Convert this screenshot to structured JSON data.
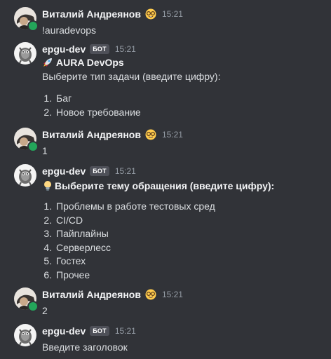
{
  "messages": [
    {
      "author": "Виталий Андреянов",
      "author_emoji": "nerd-face-emoji",
      "time": "15:21",
      "text": "!auradevops"
    },
    {
      "author": "epgu-dev",
      "bot_tag": "БОТ",
      "time": "15:21",
      "title_icon": "rocket-emoji",
      "title": "AURA DevOps",
      "prompt": "Выберите тип задачи (введите цифру):",
      "options": [
        "Баг",
        "Новое требование"
      ]
    },
    {
      "author": "Виталий Андреянов",
      "author_emoji": "nerd-face-emoji",
      "time": "15:21",
      "text": "1"
    },
    {
      "author": "epgu-dev",
      "bot_tag": "БОТ",
      "time": "15:21",
      "title_icon": "lightbulb-emoji",
      "title": "Выберите тему обращения (введите цифру):",
      "options": [
        "Проблемы в работе тестовых сред",
        "CI/CD",
        "Пайплайны",
        "Серверлесс",
        "Гостех",
        "Прочее"
      ]
    },
    {
      "author": "Виталий Андреянов",
      "author_emoji": "nerd-face-emoji",
      "time": "15:21",
      "text": "2"
    },
    {
      "author": "epgu-dev",
      "bot_tag": "БОТ",
      "time": "15:21",
      "text": "Введите заголовок"
    }
  ],
  "colors": {
    "background": "#313338",
    "username": "#f2f3f5",
    "text": "#dbdee1",
    "timestamp": "#949ba4",
    "online": "#23a55a",
    "bot_tag": "#4e5058"
  }
}
